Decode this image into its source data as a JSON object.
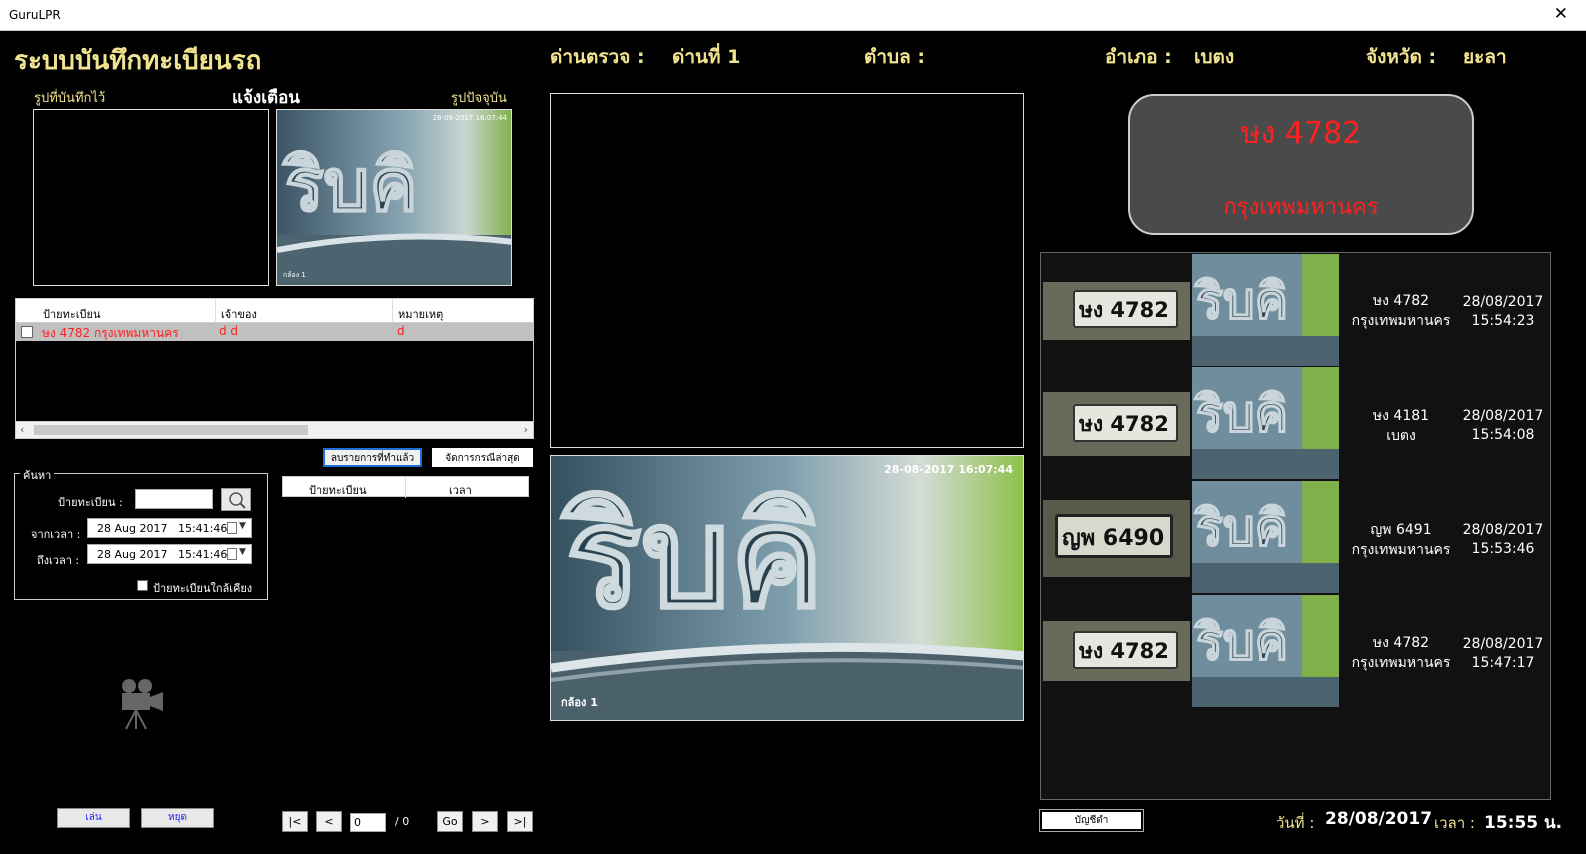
{
  "window": {
    "title": "GuruLPR",
    "close_glyph": "✕"
  },
  "header": {
    "app_title": "ระบบบันทึกทะเบียนรถ",
    "checkpoint_label": "ด่านตรวจ :",
    "checkpoint_value": "ด่านที่ 1",
    "subdistrict_label": "ตำบล :",
    "subdistrict_value": "",
    "district_label": "อำเภอ :",
    "district_value": "เบตง",
    "province_label": "จังหวัด :",
    "province_value": "ยะลา"
  },
  "alert_panel": {
    "saved_image_label": "รูปที่บันทึกไว้",
    "alert_label": "แจ้งเตือน",
    "current_image_label": "รูปปัจจุบัน",
    "cam_timestamp_small": "28-08-2017 16:07:44",
    "cam_name_small": "กล้อง 1"
  },
  "watchlist": {
    "columns": [
      "ป้ายทะเบียน",
      "เจ้าของ",
      "หมายเหตุ"
    ],
    "rows": [
      {
        "plate": "ษง 4782 กรุงเทพมหานคร",
        "owner": "d d",
        "note": "d"
      }
    ]
  },
  "actions": {
    "delete_done_label": "ลบรายการที่ทำแล้ว",
    "manage_latest_label": "จัดการกรณีล่าสุด"
  },
  "search": {
    "group_label": "ค้นหา",
    "plate_label": "ป้ายทะเบียน :",
    "plate_value": "",
    "from_label": "จากเวลา :",
    "from_value": "28 Aug 2017   15:41:46",
    "to_label": "ถึงเวลา :",
    "to_value": "28 Aug 2017   15:41:46",
    "similar_label": "ป้ายทะเบียนใกล้เคียง",
    "results_columns": [
      "ป้ายทะเบียน",
      "เวลา"
    ]
  },
  "playback": {
    "play_label": "เล่น",
    "stop_label": "หยุด"
  },
  "pager": {
    "first": "|<",
    "prev": "<",
    "page_value": "0",
    "total": "/ 0",
    "go": "Go",
    "next": ">",
    "last": ">|"
  },
  "camera": {
    "timestamp": "28-08-2017 16:07:44",
    "name": "กล้อง 1"
  },
  "detected": {
    "plate": "ษง 4782",
    "province": "กรุงเทพมหานคร"
  },
  "records": [
    {
      "plate_crop": "ษง 4782",
      "plate": "ษง 4782",
      "province": "กรุงเทพมหานคร",
      "date": "28/08/2017",
      "time": "15:54:23"
    },
    {
      "plate_crop": "ษง 4782",
      "plate": "ษง 4181",
      "province": "เบตง",
      "date": "28/08/2017",
      "time": "15:54:08"
    },
    {
      "plate_crop": "ญพ 6490",
      "plate": "ญพ 6491",
      "province": "กรุงเทพมหานคร",
      "date": "28/08/2017",
      "time": "15:53:46"
    },
    {
      "plate_crop": "ษง 4782",
      "plate": "ษง 4782",
      "province": "กรุงเทพมหานคร",
      "date": "28/08/2017",
      "time": "15:47:17"
    }
  ],
  "footer": {
    "blacklist_label": "บัญชีดำ",
    "date_label": "วันที่ :",
    "date_value": "28/08/2017",
    "time_label": "เวลา :",
    "time_value": "15:55 น."
  },
  "colors": {
    "label_yellow": "#f1e38f",
    "plate_red": "#ff2020",
    "blue_button_text": "#1a1aff"
  },
  "icons": [
    "close-icon",
    "search-icon",
    "calendar-icon",
    "movie-camera-icon"
  ]
}
